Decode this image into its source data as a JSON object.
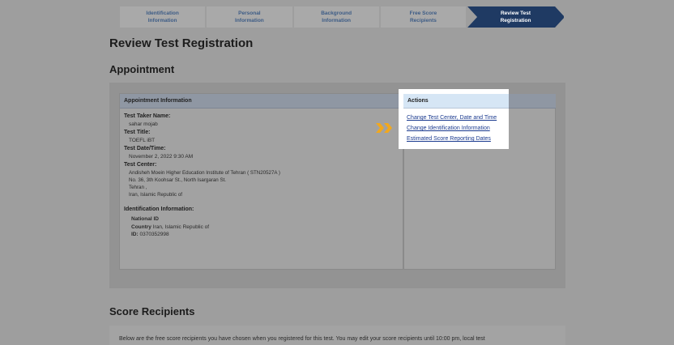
{
  "stepper": {
    "steps": [
      {
        "label": "Identification\nInformation"
      },
      {
        "label": "Personal\nInformation"
      },
      {
        "label": "Background\nInformation"
      },
      {
        "label": "Free Score\nRecipients"
      },
      {
        "label": "Review Test\nRegistration"
      }
    ],
    "active_index": 4
  },
  "page": {
    "title": "Review Test Registration",
    "appointment_heading": "Appointment",
    "score_heading": "Score Recipients"
  },
  "appointment": {
    "table_header": "Appointment Information",
    "test_taker_label": "Test Taker Name:",
    "test_taker_value": "sahar mojab",
    "test_title_label": "Test Title:",
    "test_title_value": "TOEFL iBT",
    "date_label": "Test Date/Time:",
    "date_value": "November 2, 2022 9:30 AM",
    "center_label": "Test Center:",
    "center_lines": [
      "Andisheh Moein Higher Education Institute of Tehran ( STN20527A )",
      "No. 36, 3th Koohsar St., North Isargaran St.",
      "Tehran ,",
      "Iran, Islamic Republic of"
    ],
    "id_label": "Identification Information:",
    "id_type": "National ID",
    "country_label": "Country",
    "country_value": "Iran, Islamic Republic of",
    "id_number_label": "ID:",
    "id_number_value": "0370352998"
  },
  "actions": {
    "header": "Actions",
    "links": [
      "Change Test Center, Date and Time",
      "Change Identification Information",
      "Estimated Score Reporting Dates"
    ]
  },
  "score_recipients": {
    "text": "Below are the free score recipients you have chosen when you registered for this test. You may edit your score recipients until 10:00 pm, local test"
  },
  "colors": {
    "accent_arrow": "#f2a81d",
    "active_step": "#1f3a63",
    "link": "#1a3a8f"
  }
}
